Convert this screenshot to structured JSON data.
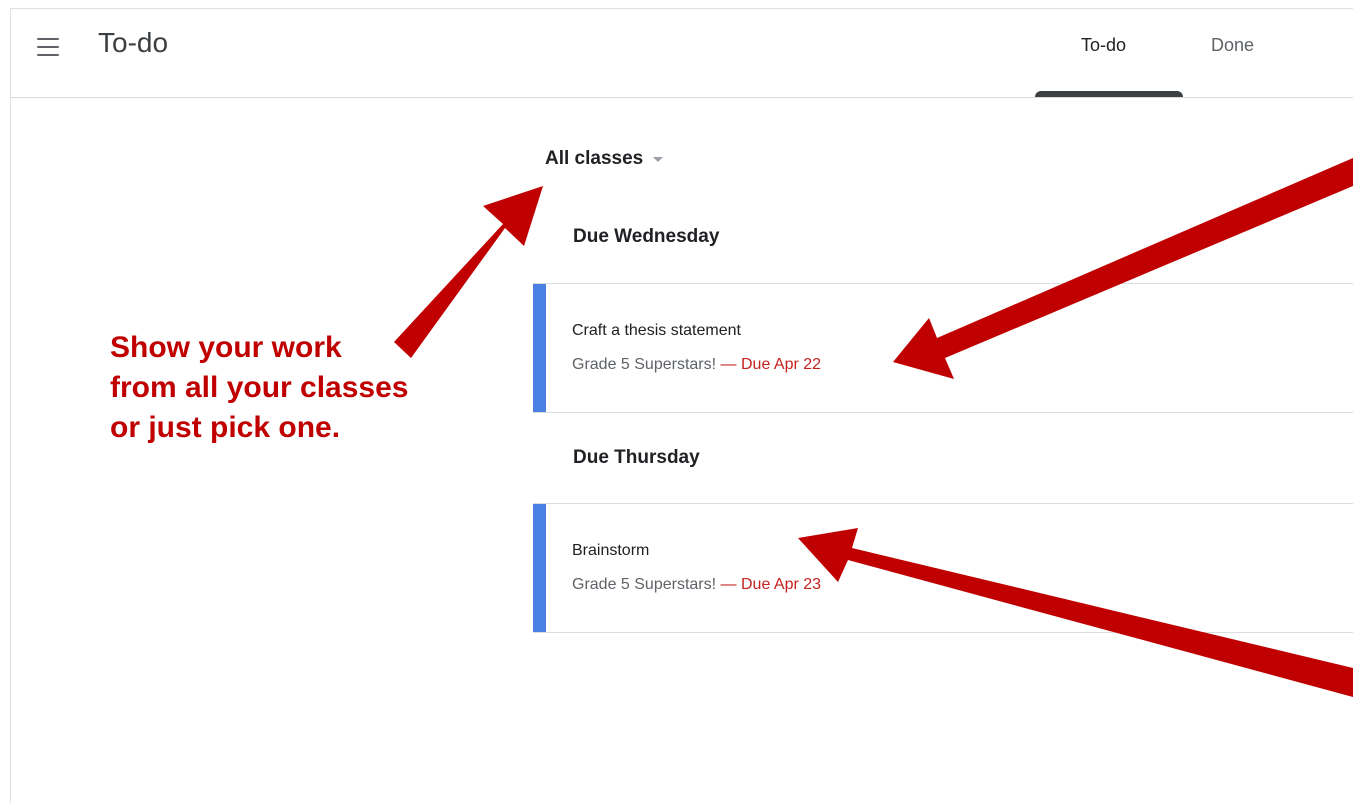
{
  "app": {
    "title": "To-do"
  },
  "tabs": [
    {
      "label": "To-do",
      "selected": true
    },
    {
      "label": "Done",
      "selected": false
    }
  ],
  "filter": {
    "label": "All classes"
  },
  "groups": [
    {
      "heading": "Due Wednesday",
      "items": [
        {
          "title": "Craft a thesis statement",
          "class_name": "Grade 5 Superstars!",
          "separator": "—",
          "due": "Due Apr 22"
        }
      ]
    },
    {
      "heading": "Due Thursday",
      "items": [
        {
          "title": "Brainstorm",
          "class_name": "Grade 5 Superstars!",
          "separator": "—",
          "due": "Due Apr 23"
        }
      ]
    }
  ],
  "annotation": {
    "text": "Show your work from all your classes or just pick one."
  },
  "colors": {
    "annotation": "#c00000",
    "due": "#c5221f",
    "card_accent": "#4a7fe4",
    "tab_indicator": "#3c4043"
  },
  "icons": {
    "menu": "hamburger-menu-icon",
    "dropdown": "caret-down-icon"
  }
}
